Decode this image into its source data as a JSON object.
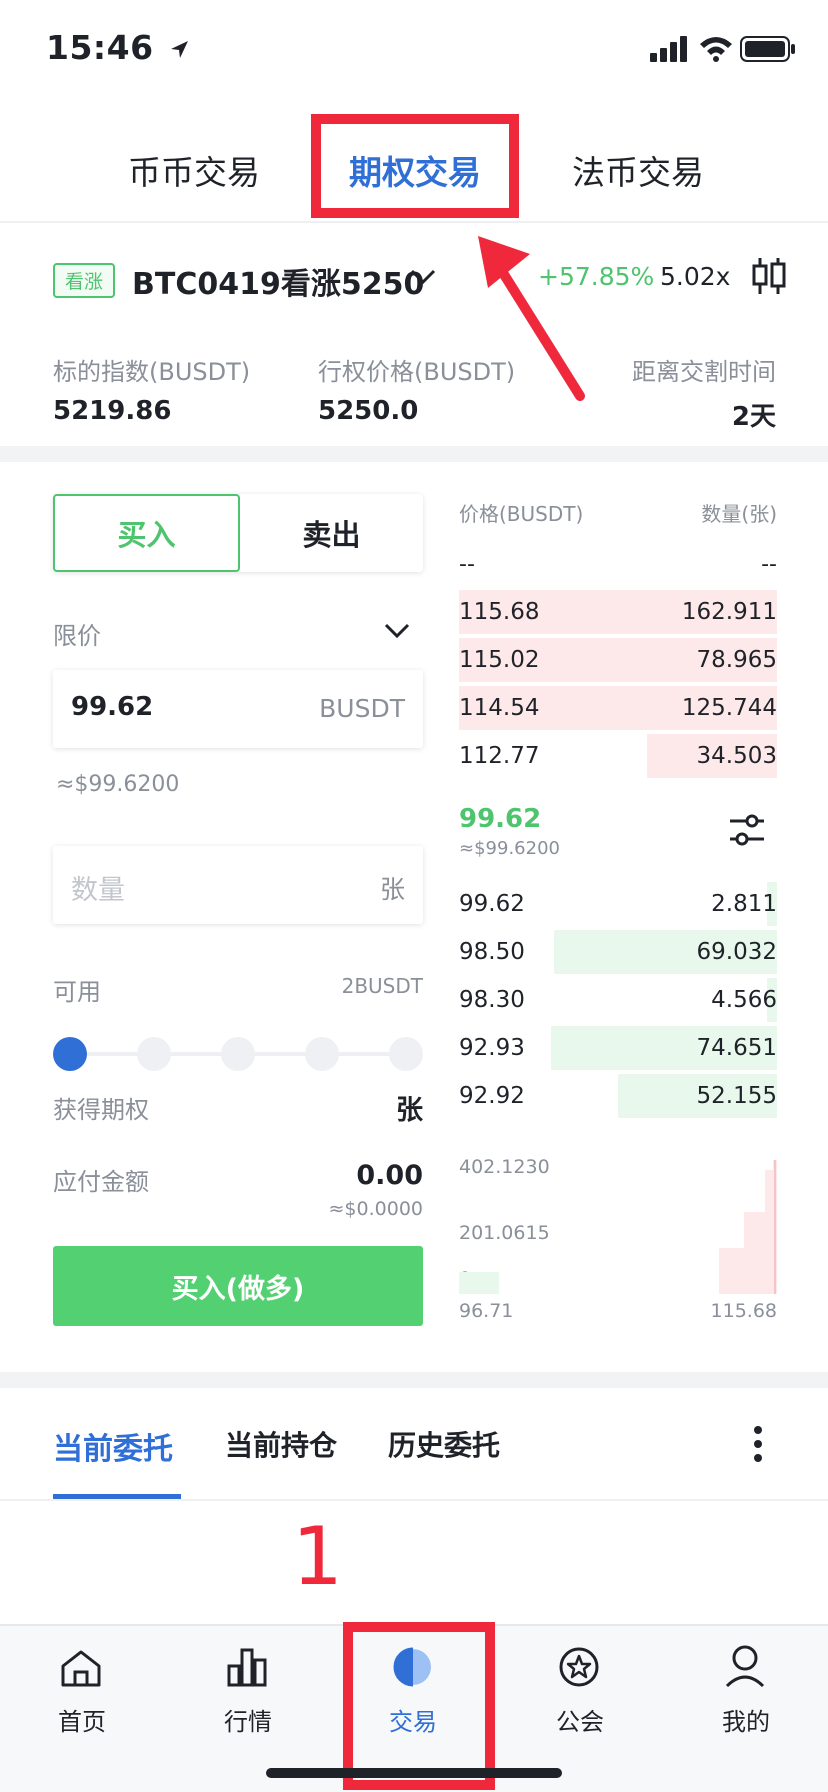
{
  "status_bar": {
    "time": "15:46"
  },
  "top_tabs": [
    {
      "label": "币币交易"
    },
    {
      "label": "期权交易",
      "active": true
    },
    {
      "label": "法币交易"
    }
  ],
  "contract": {
    "badge": "看涨",
    "name": "BTC0419看涨5250",
    "change": "+57.85%",
    "leverage": "5.02x",
    "stats": [
      {
        "label": "标的指数(BUSDT)",
        "value": "5219.86"
      },
      {
        "label": "行权价格(BUSDT)",
        "value": "5250.0"
      },
      {
        "label": "距离交割时间",
        "value": "2天"
      }
    ]
  },
  "order_form": {
    "buy_tab": "买入",
    "sell_tab": "卖出",
    "order_type": "限价",
    "price_value": "99.62",
    "price_unit": "BUSDT",
    "price_usd": "≈$99.6200",
    "quantity_placeholder": "数量",
    "quantity_unit": "张",
    "available_label": "可用",
    "available_value": "2BUSDT",
    "obtain_label": "获得期权",
    "obtain_unit": "张",
    "payable_label": "应付金额",
    "payable_value": "0.00",
    "payable_usd": "≈$0.0000",
    "submit_label": "买入(做多)"
  },
  "order_book": {
    "price_header": "价格(BUSDT)",
    "qty_header": "数量(张)",
    "placeholder_price": "--",
    "placeholder_qty": "--",
    "asks": [
      {
        "price": "115.68",
        "qty": "162.911",
        "depth": 1.0
      },
      {
        "price": "115.02",
        "qty": "78.965",
        "depth": 1.0
      },
      {
        "price": "114.54",
        "qty": "125.744",
        "depth": 1.0
      },
      {
        "price": "112.77",
        "qty": "34.503",
        "depth": 0.41
      }
    ],
    "last_price": "99.62",
    "last_price_usd": "≈$99.6200",
    "bids": [
      {
        "price": "99.62",
        "qty": "2.811",
        "depth": 0.03
      },
      {
        "price": "98.50",
        "qty": "69.032",
        "depth": 0.7
      },
      {
        "price": "98.30",
        "qty": "4.566",
        "depth": 0.03
      },
      {
        "price": "92.93",
        "qty": "74.651",
        "depth": 0.71
      },
      {
        "price": "92.92",
        "qty": "52.155",
        "depth": 0.5
      }
    ],
    "depth_y_labels": [
      "402.1230",
      "201.0615",
      "0"
    ],
    "depth_x_labels": [
      "96.71",
      "115.68"
    ]
  },
  "bottom_tabs": [
    {
      "label": "当前委托",
      "active": true
    },
    {
      "label": "当前持仓"
    },
    {
      "label": "历史委托"
    }
  ],
  "annotation_number": "1",
  "tab_bar": [
    {
      "label": "首页",
      "icon": "home-icon"
    },
    {
      "label": "行情",
      "icon": "chart-icon"
    },
    {
      "label": "交易",
      "icon": "trade-icon",
      "active": true
    },
    {
      "label": "公会",
      "icon": "guild-icon"
    },
    {
      "label": "我的",
      "icon": "profile-icon"
    }
  ],
  "colors": {
    "green": "#4fc46e",
    "blue": "#2f6fd6",
    "red_annotation": "#f0283c",
    "ask_bg": "#fde9ea",
    "bid_bg": "#e8f8ec"
  }
}
